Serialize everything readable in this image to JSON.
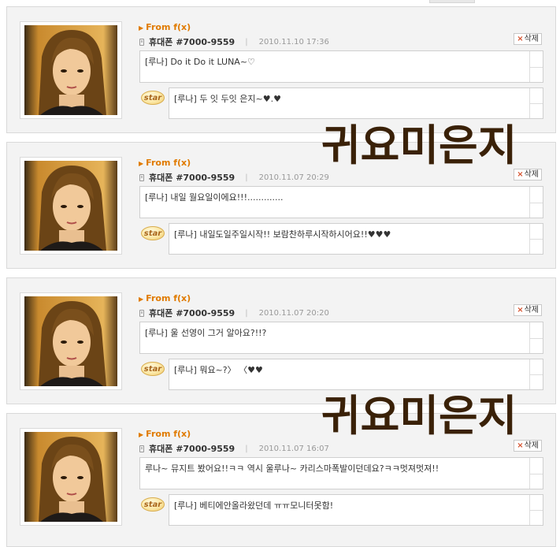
{
  "watermark_text": "귀요미은지",
  "entries": [
    {
      "from": "From f(x)",
      "sender": "휴대폰 #7000-9559",
      "separator": "|",
      "datetime": "2010.11.10 17:36",
      "delete_label": "삭제",
      "message": "[루나] Do it Do it LUNA~♡",
      "star_label": "star",
      "reply": "[루나] 두 잇 두잇 은지~♥.♥"
    },
    {
      "from": "From f(x)",
      "sender": "휴대폰 #7000-9559",
      "separator": "|",
      "datetime": "2010.11.07 20:29",
      "delete_label": "삭제",
      "message": "[루나] 내일 월요일이에요!!!.............",
      "star_label": "star",
      "reply": "[루나] 내일도일주일시작!! 보람찬하루시작하시어요!!♥♥♥"
    },
    {
      "from": "From f(x)",
      "sender": "휴대폰 #7000-9559",
      "separator": "|",
      "datetime": "2010.11.07 20:20",
      "delete_label": "삭제",
      "message": "[루나] 울 선영이 그거 알아요?!!?",
      "star_label": "star",
      "reply": "[루나] 뭐요~?〉 〈♥♥"
    },
    {
      "from": "From f(x)",
      "sender": "휴대폰 #7000-9559",
      "separator": "|",
      "datetime": "2010.11.07 16:07",
      "delete_label": "삭제",
      "message": "루나~ 뮤지트 봤어요!!ㅋㅋ 역시 울루나~ 카리스마폭발이던데요?ㅋㅋ멋져멋져!!",
      "star_label": "star",
      "reply": "[루나] 베티에안올라왔던데 ㅠㅠ모니터못함!"
    }
  ]
}
